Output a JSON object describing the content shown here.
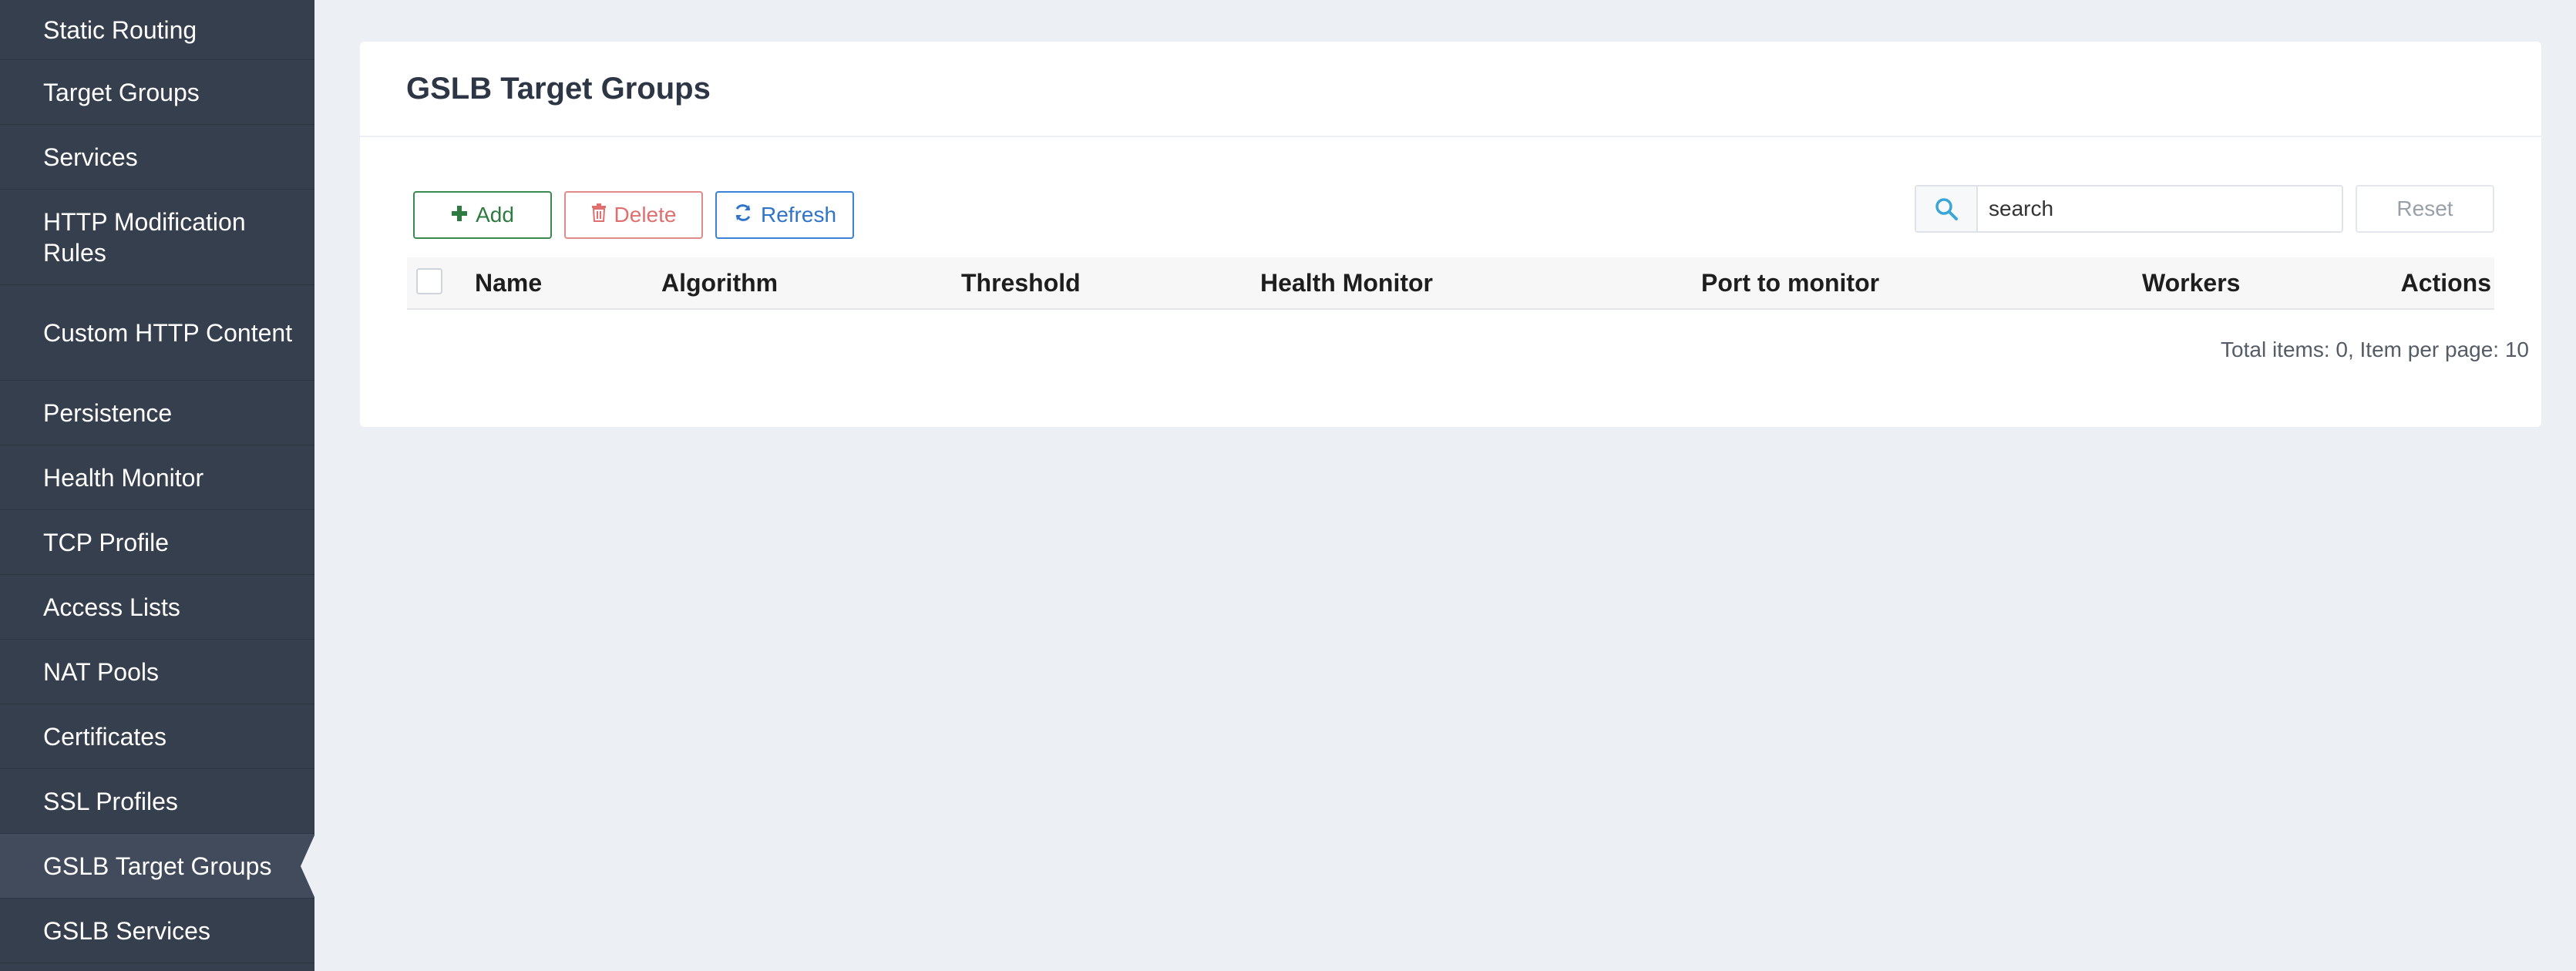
{
  "sidebar": {
    "items": [
      {
        "label": "Static Routing"
      },
      {
        "label": "Target Groups"
      },
      {
        "label": "Services"
      },
      {
        "label": "HTTP Modification Rules"
      },
      {
        "label": "Custom HTTP Content"
      },
      {
        "label": "Persistence"
      },
      {
        "label": "Health Monitor"
      },
      {
        "label": "TCP Profile"
      },
      {
        "label": "Access Lists"
      },
      {
        "label": "NAT Pools"
      },
      {
        "label": "Certificates"
      },
      {
        "label": "SSL Profiles"
      },
      {
        "label": "GSLB Target Groups"
      },
      {
        "label": "GSLB Services"
      }
    ],
    "active_item": "GSLB Target Groups"
  },
  "page": {
    "title": "GSLB Target Groups"
  },
  "toolbar": {
    "add_label": "Add",
    "delete_label": "Delete",
    "refresh_label": "Refresh",
    "reset_label": "Reset"
  },
  "search": {
    "value": "search",
    "placeholder": "search"
  },
  "table": {
    "columns": [
      "Name",
      "Algorithm",
      "Threshold",
      "Health Monitor",
      "Port to monitor",
      "Workers",
      "Actions"
    ],
    "rows": []
  },
  "footer": {
    "summary": "Total items: 0, Item per page: 10"
  },
  "colors": {
    "sidebar_bg": "#363f4d",
    "page_bg": "#eceff3",
    "add_accent": "#2e7a41",
    "delete_accent": "#e07070",
    "refresh_accent": "#2f74c8",
    "search_icon": "#3aa6d8"
  },
  "icons": {
    "add": "plus-icon",
    "delete": "trash-icon",
    "refresh": "refresh-icon",
    "search": "search-icon"
  }
}
